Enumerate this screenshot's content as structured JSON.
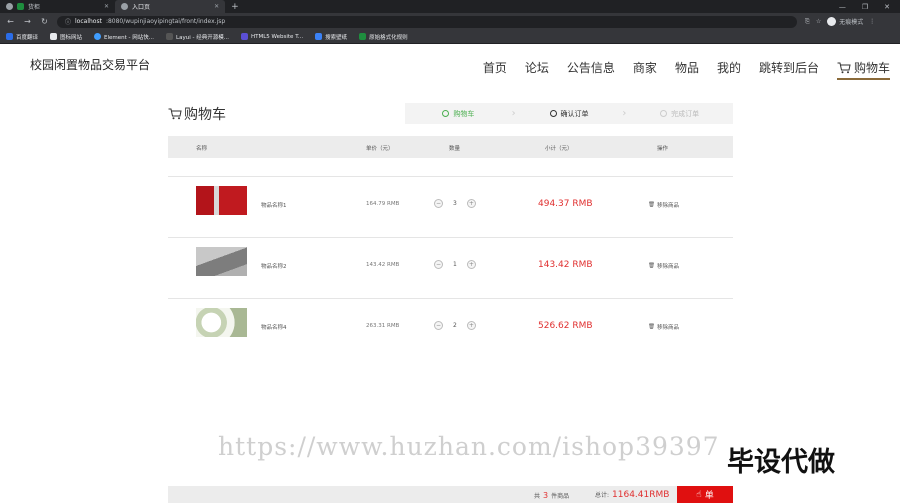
{
  "browser": {
    "tabs": [
      {
        "title": "货柜",
        "active": false
      },
      {
        "title": "入口页",
        "active": true
      }
    ],
    "url_host": "localhost",
    "url_path": ":8080/wupinjiaoyipingtai/front/index.jsp",
    "profile_label": "无痕模式",
    "bookmarks": [
      "百度翻译",
      "图标网站",
      "Element - 网站快...",
      "Layui - 经典开源模...",
      "HTML5 Website T...",
      "搜索壁纸",
      "原始格式化规则"
    ]
  },
  "site": {
    "title": "校园闲置物品交易平台",
    "nav": [
      "首页",
      "论坛",
      "公告信息",
      "商家",
      "物品",
      "我的",
      "跳转到后台"
    ],
    "nav_cart": "购物车"
  },
  "cart": {
    "title": "购物车",
    "steps": [
      "购物车",
      "确认订单",
      "完成订单"
    ],
    "columns": [
      "名称",
      "单价（元）",
      "数量",
      "小计（元）",
      "操作"
    ],
    "rows": [
      {
        "name": "物品名称1",
        "price": "164.79 RMB",
        "qty": "3",
        "subtotal": "494.37 RMB",
        "remove": "移除商品",
        "thumb_color": "#b3141a"
      },
      {
        "name": "物品名称2",
        "price": "143.42 RMB",
        "qty": "1",
        "subtotal": "143.42 RMB",
        "remove": "移除商品",
        "thumb_color": "#9a9a9a"
      },
      {
        "name": "物品名称4",
        "price": "263.31 RMB",
        "qty": "2",
        "subtotal": "526.62 RMB",
        "remove": "移除商品",
        "thumb_color": "#dfe6d5"
      }
    ],
    "footer": {
      "count_prefix": "共",
      "count": "3",
      "count_suffix": "件商品",
      "total_label": "总计:",
      "total": "1164.41RMB",
      "checkout_label": "单"
    }
  },
  "watermark": {
    "url": "https://www.huzhan.com/ishop39397",
    "badge": "毕设代做"
  },
  "colors": {
    "accent_red": "#e03030",
    "step_active": "#4caf50",
    "nav_underline": "#8a6a3a"
  }
}
